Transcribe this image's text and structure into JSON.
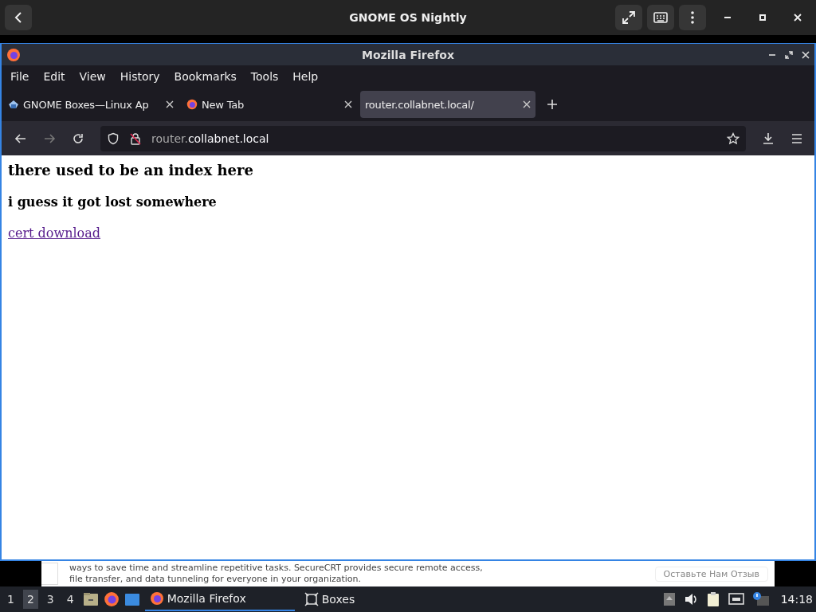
{
  "host_bar": {
    "title": "GNOME OS Nightly"
  },
  "window": {
    "title": "Mozilla Firefox"
  },
  "menu": [
    {
      "label": "File"
    },
    {
      "label": "Edit"
    },
    {
      "label": "View"
    },
    {
      "label": "History"
    },
    {
      "label": "Bookmarks"
    },
    {
      "label": "Tools"
    },
    {
      "label": "Help"
    }
  ],
  "tabs": [
    {
      "label": "GNOME Boxes—Linux Ap",
      "kind": "boxes",
      "selected": false
    },
    {
      "label": "New Tab",
      "kind": "firefox",
      "selected": false
    },
    {
      "label": "router.collabnet.local/",
      "kind": "none",
      "selected": true
    }
  ],
  "address": {
    "host_prefix": "router.",
    "domain": "collabnet.local"
  },
  "page": {
    "heading": "there used to be an index here",
    "subheading": "i guess it got lost somewhere",
    "link": "cert download"
  },
  "background_app": {
    "line_1": "ways to save time and streamline repetitive tasks. SecureCRT provides secure remote access,",
    "line_2": "file transfer, and data tunneling for everyone in your organization.",
    "button": "Оставьте Нам Отзыв"
  },
  "taskbar": {
    "workspaces": [
      {
        "label": "1",
        "selected": false
      },
      {
        "label": "2",
        "selected": true
      },
      {
        "label": "3",
        "selected": false
      },
      {
        "label": "4",
        "selected": false
      }
    ],
    "tasks": [
      {
        "label": "Mozilla Firefox",
        "kind": "firefox",
        "selected": true
      },
      {
        "label": "Boxes",
        "kind": "boxes",
        "selected": false
      }
    ],
    "clock": "14:18"
  }
}
